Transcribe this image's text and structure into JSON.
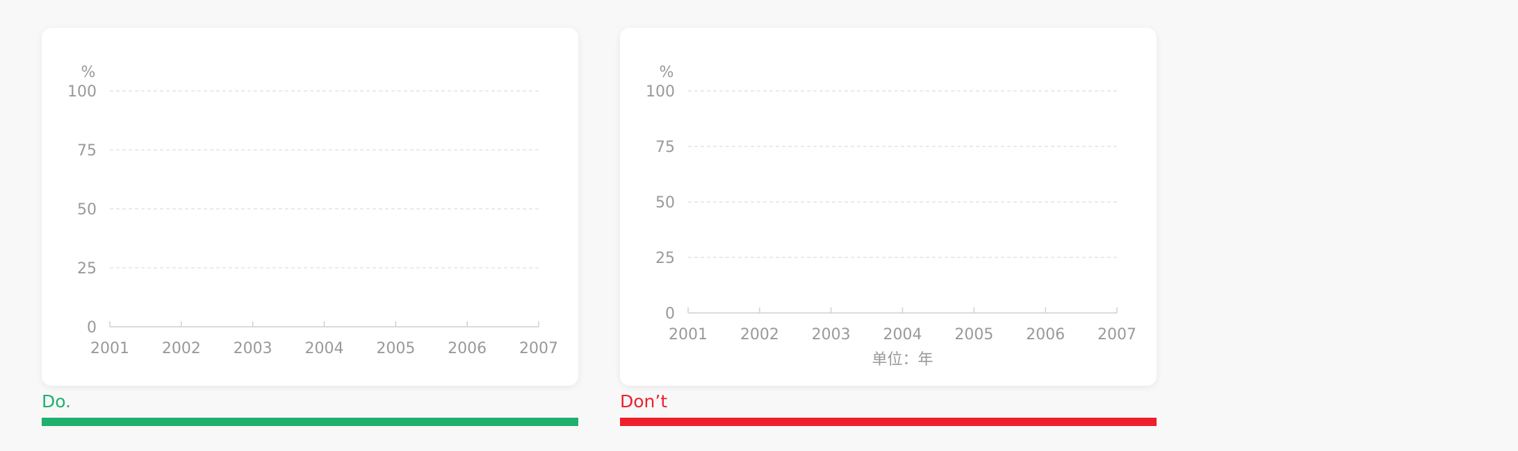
{
  "colors": {
    "do": "#1faf6e",
    "dont": "#ee1f2b",
    "axis_text": "#999999",
    "grid": "#e4e4e4",
    "axis_line": "#d0d0d0"
  },
  "examples": [
    {
      "verdict": "Do.",
      "verdict_color": "#1faf6e"
    },
    {
      "verdict": "Don’t",
      "verdict_color": "#ee1f2b"
    }
  ],
  "chart_data": [
    {
      "type": "line",
      "title": "",
      "xlabel": "",
      "ylabel": "%",
      "x": [
        "2001",
        "2002",
        "2003",
        "2004",
        "2005",
        "2006",
        "2007"
      ],
      "y_ticks": [
        "0",
        "25",
        "50",
        "75",
        "100"
      ],
      "ylim": [
        0,
        100
      ],
      "series": [],
      "grid": true
    },
    {
      "type": "line",
      "title": "",
      "xlabel": "单位：年",
      "ylabel": "%",
      "x": [
        "2001",
        "2002",
        "2003",
        "2004",
        "2005",
        "2006",
        "2007"
      ],
      "y_ticks": [
        "0",
        "25",
        "50",
        "75",
        "100"
      ],
      "ylim": [
        0,
        100
      ],
      "series": [],
      "grid": true
    }
  ]
}
